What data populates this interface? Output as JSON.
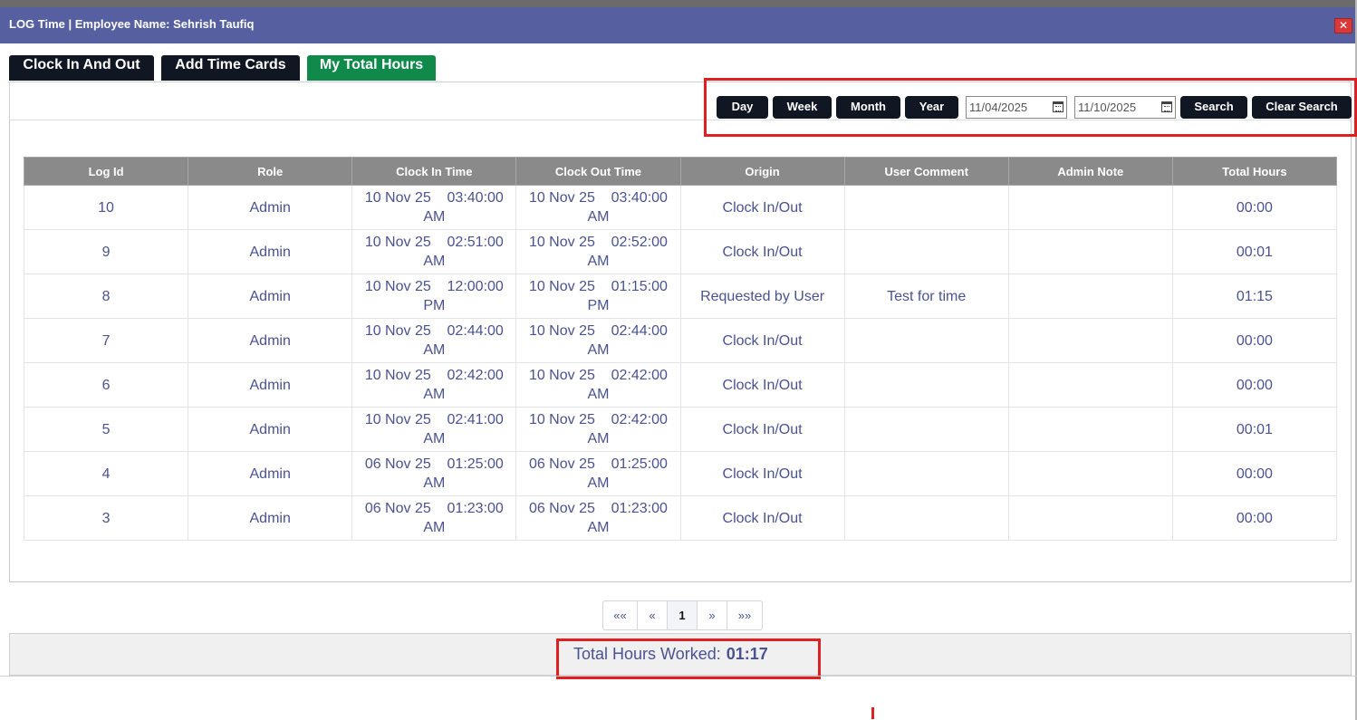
{
  "window": {
    "title": "LOG Time | Employee Name: Sehrish Taufiq",
    "close_icon": "close-icon"
  },
  "tabs": [
    {
      "label": "Clock In And Out",
      "active": false
    },
    {
      "label": "Add Time Cards",
      "active": false
    },
    {
      "label": "My Total Hours",
      "active": true
    }
  ],
  "filters": {
    "day": "Day",
    "week": "Week",
    "month": "Month",
    "year": "Year",
    "from_date": "11/04/2025",
    "to_date": "11/10/2025",
    "search": "Search",
    "clear_search": "Clear Search",
    "calendar_icon": "calendar-icon"
  },
  "table": {
    "columns": [
      "Log Id",
      "Role",
      "Clock In Time",
      "Clock Out Time",
      "Origin",
      "User Comment",
      "Admin Note",
      "Total Hours"
    ],
    "rows": [
      {
        "log_id": "10",
        "role": "Admin",
        "clock_in": "10 Nov 25    03:40:00 AM",
        "clock_out": "10 Nov 25    03:40:00 AM",
        "origin": "Clock In/Out",
        "user_comment": "",
        "admin_note": "",
        "total_hours": "00:00"
      },
      {
        "log_id": "9",
        "role": "Admin",
        "clock_in": "10 Nov 25    02:51:00 AM",
        "clock_out": "10 Nov 25    02:52:00 AM",
        "origin": "Clock In/Out",
        "user_comment": "",
        "admin_note": "",
        "total_hours": "00:01"
      },
      {
        "log_id": "8",
        "role": "Admin",
        "clock_in": "10 Nov 25    12:00:00 PM",
        "clock_out": "10 Nov 25    01:15:00 PM",
        "origin": "Requested by User",
        "user_comment": "Test for time",
        "admin_note": "",
        "total_hours": "01:15"
      },
      {
        "log_id": "7",
        "role": "Admin",
        "clock_in": "10 Nov 25    02:44:00 AM",
        "clock_out": "10 Nov 25    02:44:00 AM",
        "origin": "Clock In/Out",
        "user_comment": "",
        "admin_note": "",
        "total_hours": "00:00"
      },
      {
        "log_id": "6",
        "role": "Admin",
        "clock_in": "10 Nov 25    02:42:00 AM",
        "clock_out": "10 Nov 25    02:42:00 AM",
        "origin": "Clock In/Out",
        "user_comment": "",
        "admin_note": "",
        "total_hours": "00:00"
      },
      {
        "log_id": "5",
        "role": "Admin",
        "clock_in": "10 Nov 25    02:41:00 AM",
        "clock_out": "10 Nov 25    02:42:00 AM",
        "origin": "Clock In/Out",
        "user_comment": "",
        "admin_note": "",
        "total_hours": "00:01"
      },
      {
        "log_id": "4",
        "role": "Admin",
        "clock_in": "06 Nov 25    01:25:00 AM",
        "clock_out": "06 Nov 25    01:25:00 AM",
        "origin": "Clock In/Out",
        "user_comment": "",
        "admin_note": "",
        "total_hours": "00:00"
      },
      {
        "log_id": "3",
        "role": "Admin",
        "clock_in": "06 Nov 25    01:23:00 AM",
        "clock_out": "06 Nov 25    01:23:00 AM",
        "origin": "Clock In/Out",
        "user_comment": "",
        "admin_note": "",
        "total_hours": "00:00"
      }
    ]
  },
  "pagination": {
    "first": "««",
    "prev": "«",
    "current": "1",
    "next": "»",
    "last": "»»"
  },
  "summary": {
    "label": "Total Hours Worked:",
    "value": "01:17"
  },
  "colors": {
    "titlebar": "#5660a0",
    "tab_dark": "#101622",
    "tab_active": "#0f8a4a",
    "table_header": "#8a8a8a",
    "text": "#4a5290",
    "highlight": "#e02020"
  }
}
